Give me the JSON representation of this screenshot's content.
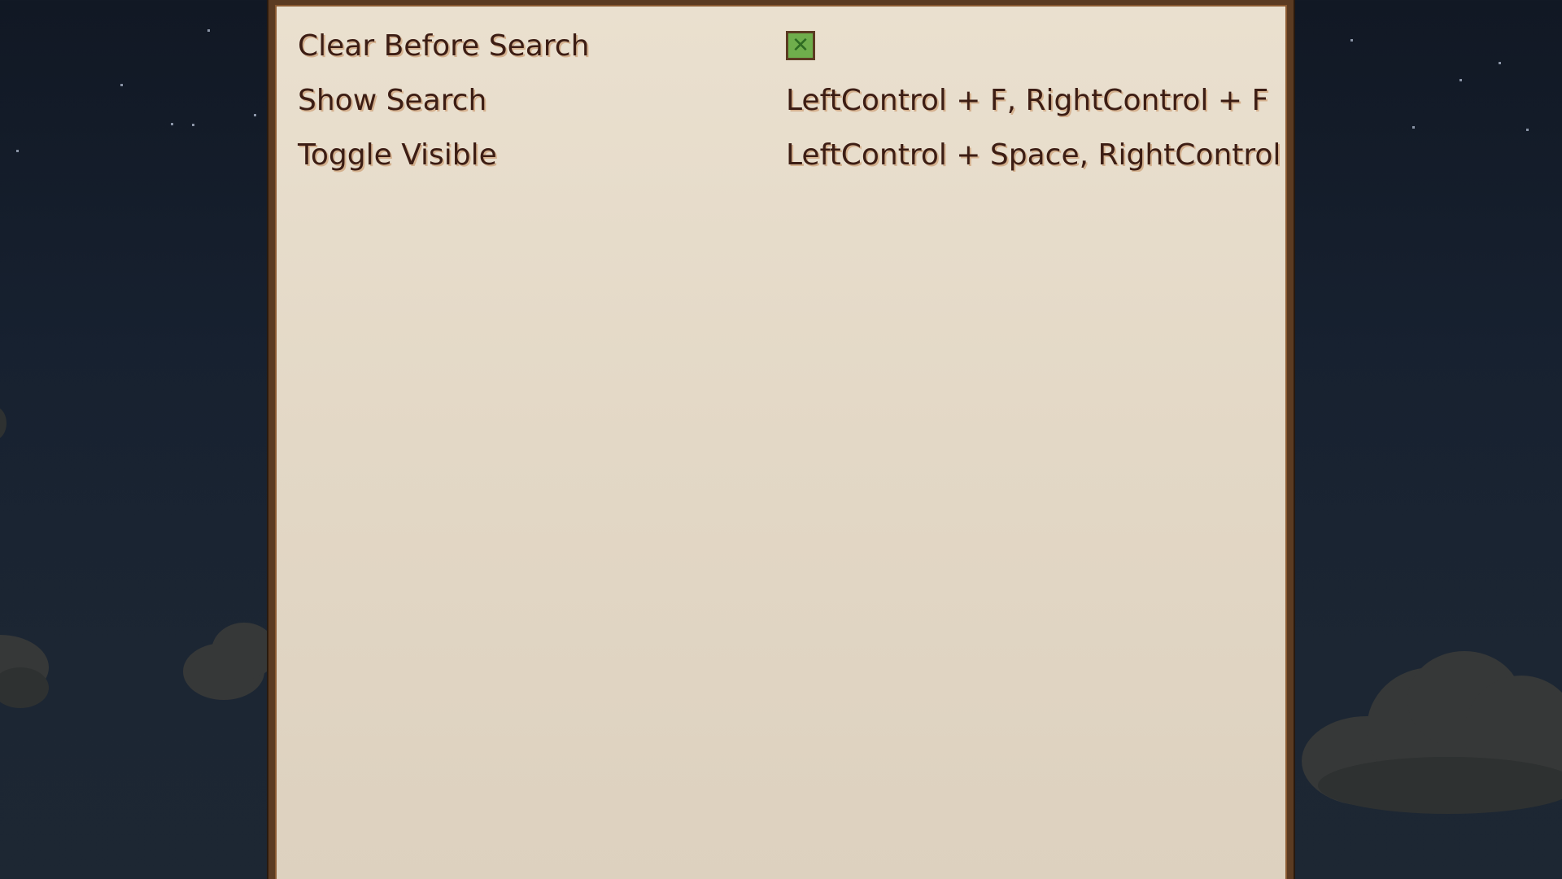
{
  "options": [
    {
      "label": "Clear Before Search",
      "type": "checkbox",
      "checked": true
    },
    {
      "label": "Show Search",
      "type": "keybind",
      "value": "LeftControl + F, RightControl + F"
    },
    {
      "label": "Toggle Visible",
      "type": "keybind",
      "value": "LeftControl + Space, RightControl + Space"
    }
  ],
  "icons": {
    "checkbox_mark": "check-x-icon"
  },
  "colors": {
    "panel_bg": "#eae0cf",
    "panel_border": "#5b3b22",
    "text": "#3c1d14",
    "checkbox_fill": "#6fae4c",
    "sky": "#111824"
  }
}
